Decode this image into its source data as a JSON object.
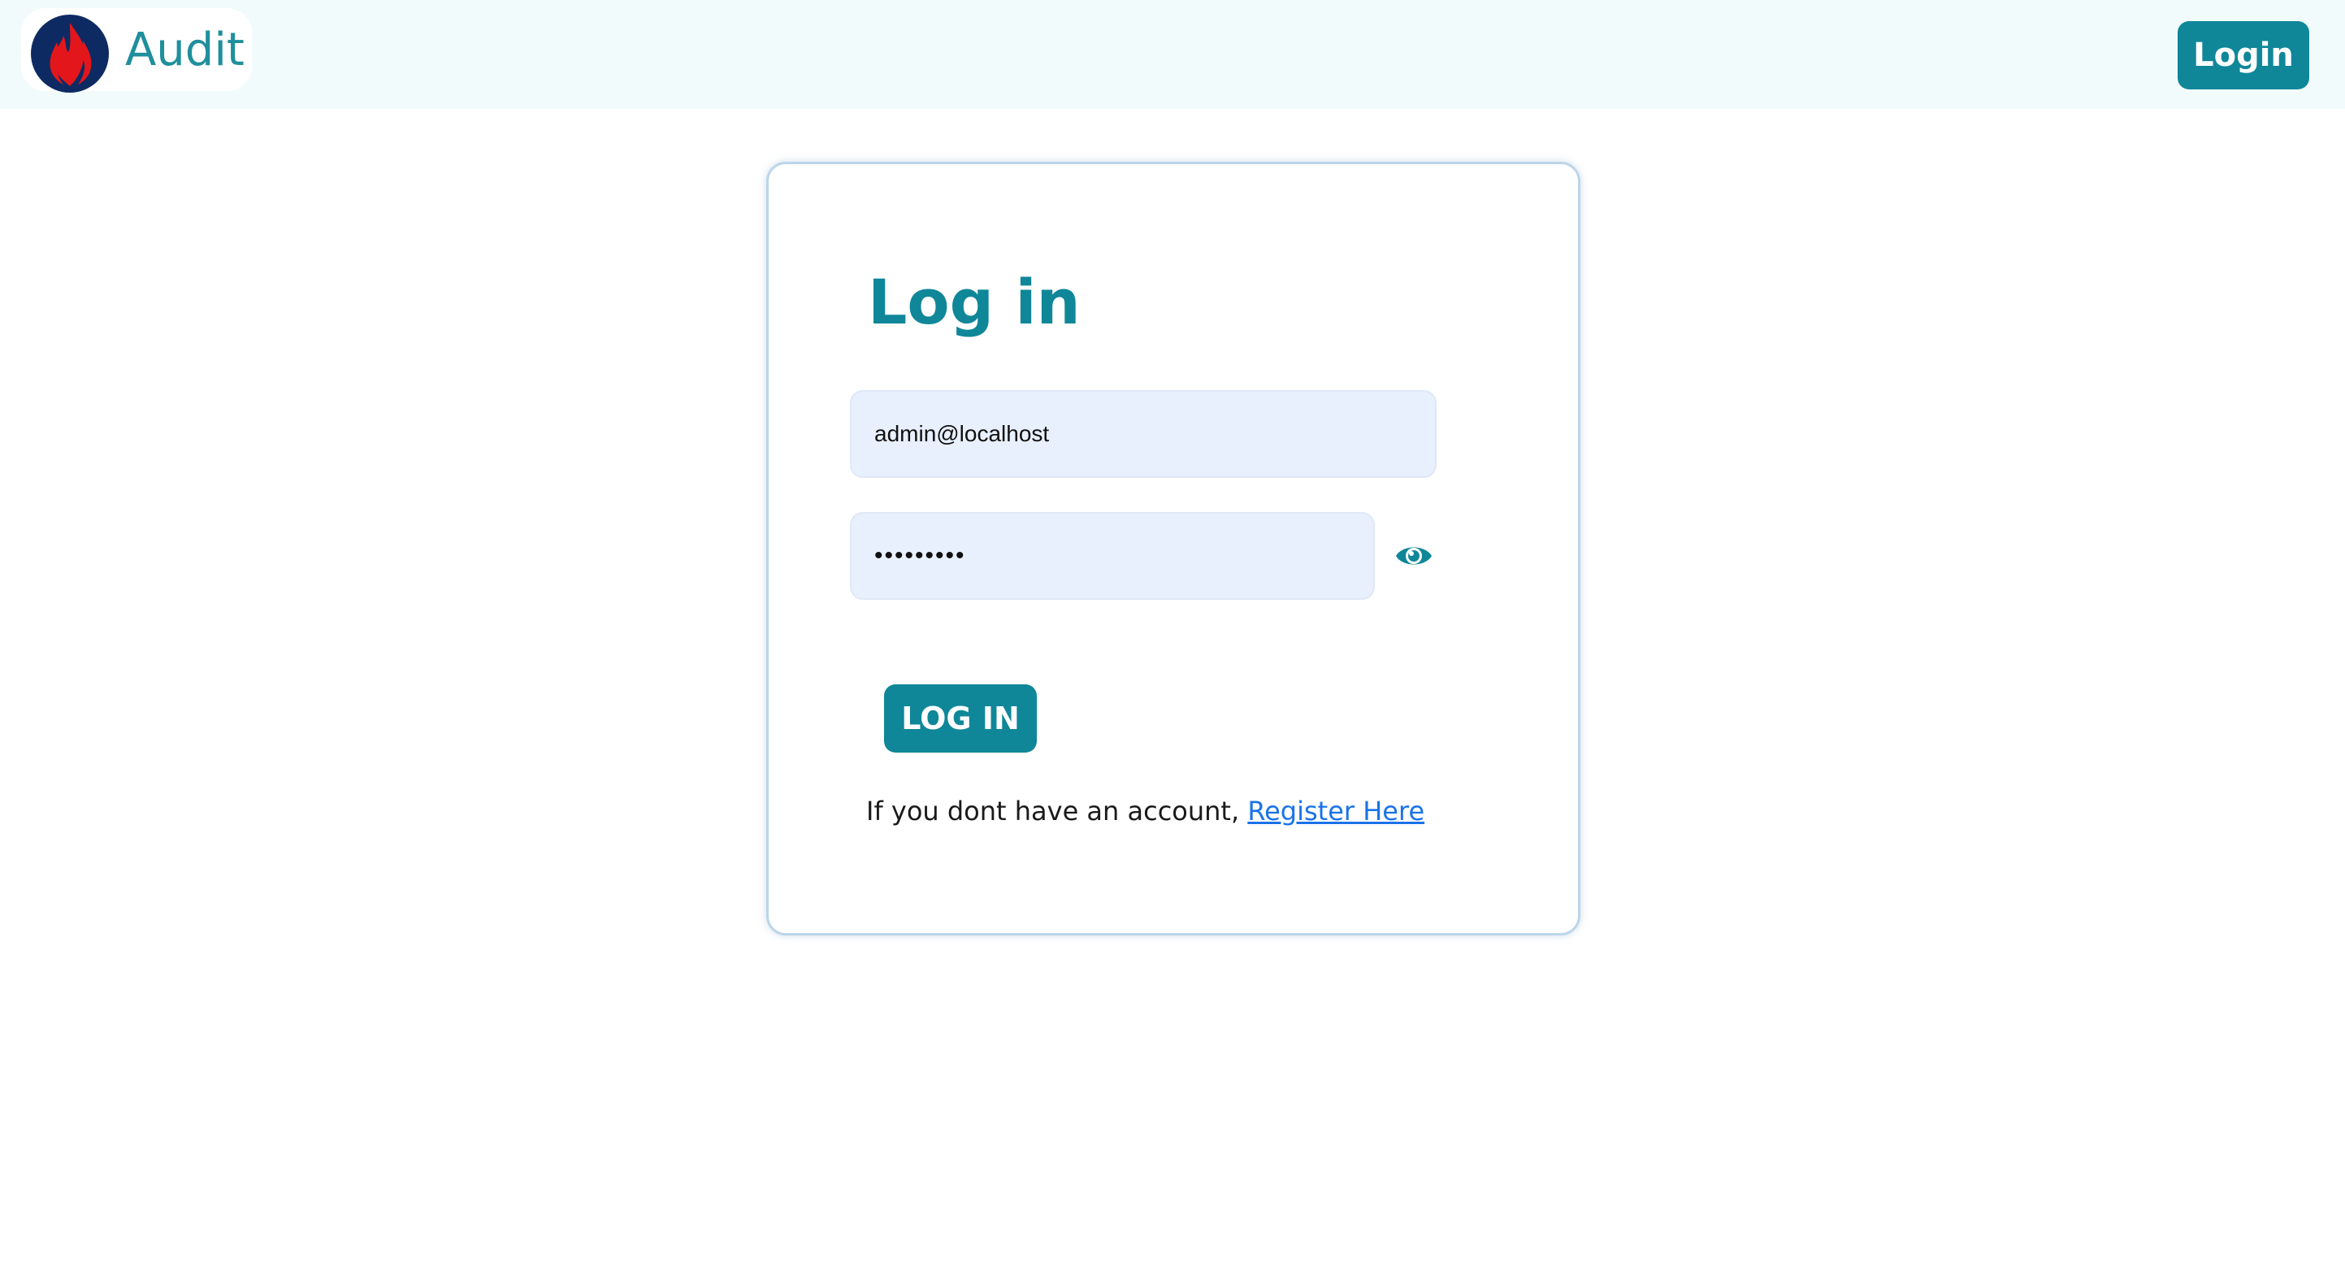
{
  "navbar": {
    "brand_name": "Audit",
    "logo_icon": "flame-logo-icon",
    "login_label": "Login",
    "colors": {
      "background": "#f2fbfb",
      "brand_text": "#1f8f9c",
      "button": "#0f8799"
    }
  },
  "login_card": {
    "title": "Log in",
    "email_value": "admin@localhost",
    "password_value": "•••••••••",
    "password_toggle_icon": "eye-icon",
    "submit_label": "LOG IN",
    "register_prompt": "If you dont have an account,",
    "register_link": "Register Here",
    "colors": {
      "accent": "#0f8799",
      "input_bg": "#e8f0fe",
      "link": "#1a73e8",
      "border": "#bcd6ea"
    }
  }
}
